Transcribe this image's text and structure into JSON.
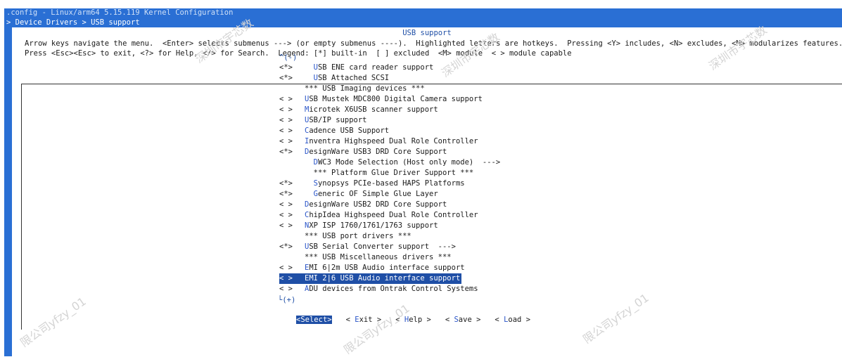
{
  "window": {
    "title": ".config - Linux/arm64 5.15.119 Kernel Configuration",
    "breadcrumb": "> Device Drivers > USB support"
  },
  "dialog": {
    "title": "USB support",
    "help_line1": "Arrow keys navigate the menu.  <Enter> selects submenus ---> (or empty submenus ----).  Highlighted letters are hotkeys.  Pressing <Y> includes, <N> excludes, <M> modularizes features.",
    "help_line2": "Press <Esc><Esc> to exit, <?> for Help, </> for Search.  Legend: [*] built-in  [ ] excluded  <M> module  < > module capable",
    "scroll_up": "^(-)",
    "scroll_down": "└(+)"
  },
  "menu": [
    {
      "state": "<*>",
      "indent": "  ",
      "hot": "U",
      "rest": "SB ENE card reader support"
    },
    {
      "state": "<*>",
      "indent": "  ",
      "hot": "U",
      "rest": "SB Attached SCSI"
    },
    {
      "state": "",
      "indent": "",
      "hot": "",
      "rest": "*** USB Imaging devices ***"
    },
    {
      "state": "< >",
      "indent": "",
      "hot": "U",
      "rest": "SB Mustek MDC800 Digital Camera support"
    },
    {
      "state": "< >",
      "indent": "",
      "hot": "M",
      "rest": "icrotek X6USB scanner support"
    },
    {
      "state": "< >",
      "indent": "",
      "hot": "U",
      "rest": "SB/IP support"
    },
    {
      "state": "< >",
      "indent": "",
      "hot": "C",
      "rest": "adence USB Support"
    },
    {
      "state": "< >",
      "indent": "",
      "hot": "I",
      "rest": "nventra Highspeed Dual Role Controller"
    },
    {
      "state": "<*>",
      "indent": "",
      "hot": "D",
      "rest": "esignWare USB3 DRD Core Support"
    },
    {
      "state": "",
      "indent": "  ",
      "hot": "D",
      "rest": "WC3 Mode Selection (Host only mode)  --->"
    },
    {
      "state": "",
      "indent": "  ",
      "hot": "",
      "rest": "*** Platform Glue Driver Support ***"
    },
    {
      "state": "<*>",
      "indent": "  ",
      "hot": "S",
      "rest": "ynopsys PCIe-based HAPS Platforms"
    },
    {
      "state": "<*>",
      "indent": "  ",
      "hot": "G",
      "rest": "eneric OF Simple Glue Layer"
    },
    {
      "state": "< >",
      "indent": "",
      "hot": "D",
      "rest": "esignWare USB2 DRD Core Support"
    },
    {
      "state": "< >",
      "indent": "",
      "hot": "C",
      "rest": "hipIdea Highspeed Dual Role Controller"
    },
    {
      "state": "< >",
      "indent": "",
      "hot": "N",
      "rest": "XP ISP 1760/1761/1763 support"
    },
    {
      "state": "",
      "indent": "",
      "hot": "",
      "rest": "*** USB port drivers ***"
    },
    {
      "state": "<*>",
      "indent": "",
      "hot": "U",
      "rest": "SB Serial Converter support  --->"
    },
    {
      "state": "",
      "indent": "",
      "hot": "",
      "rest": "*** USB Miscellaneous drivers ***"
    },
    {
      "state": "< >",
      "indent": "",
      "hot": "E",
      "rest": "MI 6|2m USB Audio interface support"
    },
    {
      "state": "< >",
      "indent": "",
      "hot": "E",
      "rest": "MI 2|6 USB Audio interface support",
      "selected": true
    },
    {
      "state": "< >",
      "indent": "",
      "hot": "A",
      "rest": "DU devices from Ontrak Control Systems"
    }
  ],
  "buttons": [
    {
      "open": "<",
      "hot": "S",
      "rest": "elect",
      "close": ">",
      "active": true
    },
    {
      "open": "< ",
      "hot": "E",
      "rest": "xit",
      "close": " >",
      "active": false
    },
    {
      "open": "< ",
      "hot": "H",
      "rest": "elp",
      "close": " >",
      "active": false
    },
    {
      "open": "< ",
      "hot": "S",
      "rest": "ave",
      "close": " >",
      "active": false
    },
    {
      "open": "< ",
      "hot": "L",
      "rest": "oad",
      "close": " >",
      "active": false
    }
  ],
  "watermark": [
    "深圳市宇芯数",
    "深圳市宇芯数",
    "深圳市宇芯数",
    "限公司yfzy_01",
    "限公司yfzy_01",
    "限公司yfzy_01"
  ],
  "colors": {
    "background": "#2a6fd4",
    "selection": "#1f4fa6",
    "hotkey": "#2a55c8"
  }
}
